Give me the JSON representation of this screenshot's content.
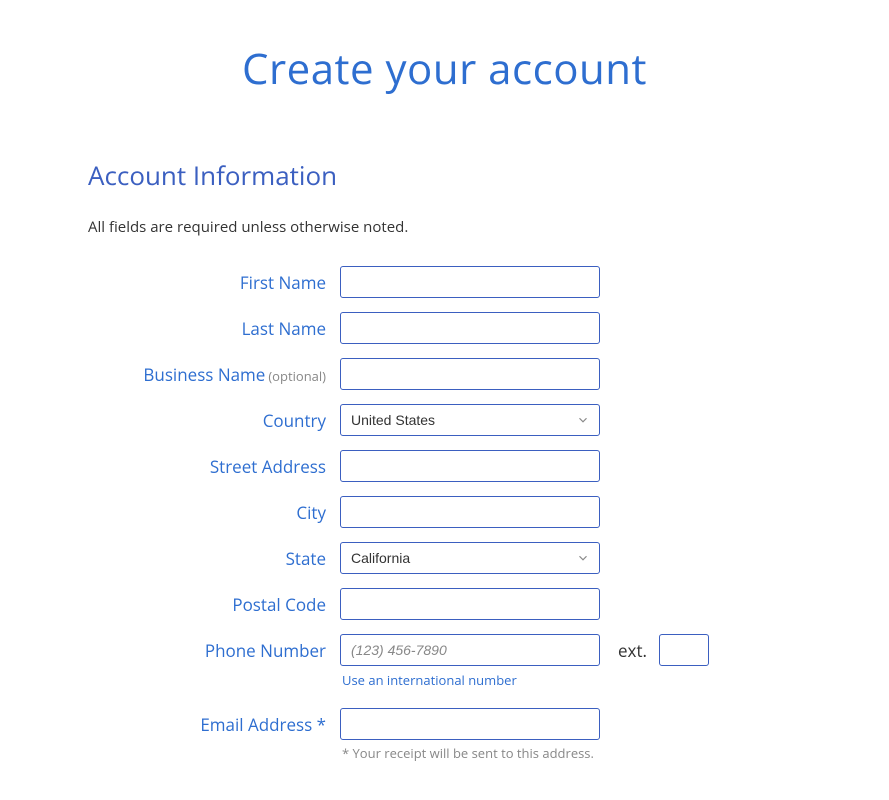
{
  "page": {
    "title": "Create your account",
    "section": "Account Information",
    "requiredNote": "All fields are required unless otherwise noted."
  },
  "form": {
    "firstName": {
      "label": "First Name",
      "value": ""
    },
    "lastName": {
      "label": "Last Name",
      "value": ""
    },
    "businessName": {
      "label": "Business Name",
      "optional": "(optional)",
      "value": ""
    },
    "country": {
      "label": "Country",
      "value": "United States"
    },
    "streetAddress": {
      "label": "Street Address",
      "value": ""
    },
    "city": {
      "label": "City",
      "value": ""
    },
    "state": {
      "label": "State",
      "value": "California"
    },
    "postalCode": {
      "label": "Postal Code",
      "value": ""
    },
    "phone": {
      "label": "Phone Number",
      "placeholder": "(123) 456-7890",
      "value": "",
      "extLabel": "ext.",
      "extValue": "",
      "intlLink": "Use an international number"
    },
    "email": {
      "label": "Email Address *",
      "value": "",
      "note": "* Your receipt will be sent to this address."
    }
  }
}
